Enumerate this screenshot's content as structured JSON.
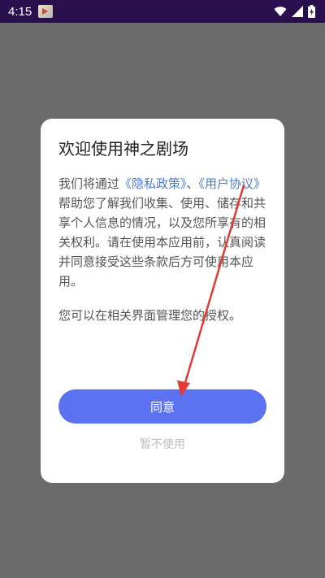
{
  "status_bar": {
    "time": "4:15",
    "icons": [
      "app-thumbnail-icon",
      "wifi-icon",
      "signal-icon",
      "battery-charging-icon"
    ]
  },
  "dialog": {
    "title": "欢迎使用神之剧场",
    "body": {
      "prefix": "我们将通过",
      "link_privacy": "《隐私政策》",
      "separator": "、",
      "link_user": "《用户协议》",
      "suffix": "帮助您了解我们收集、使用、储存和共享个人信息的情况，以及您所享有的相关权利。请在使用本应用前，认真阅读并同意接受这些条款后方可使用本应用。"
    },
    "note": "您可以在相关界面管理您的授权。",
    "agree_label": "同意",
    "decline_label": "暂不使用"
  },
  "colors": {
    "overlay": "#6b6b6b",
    "status_bar": "#2a0f4e",
    "link": "#4a7bdb",
    "primary_button": "#5b73f0",
    "annotation_arrow": "#e53935"
  }
}
